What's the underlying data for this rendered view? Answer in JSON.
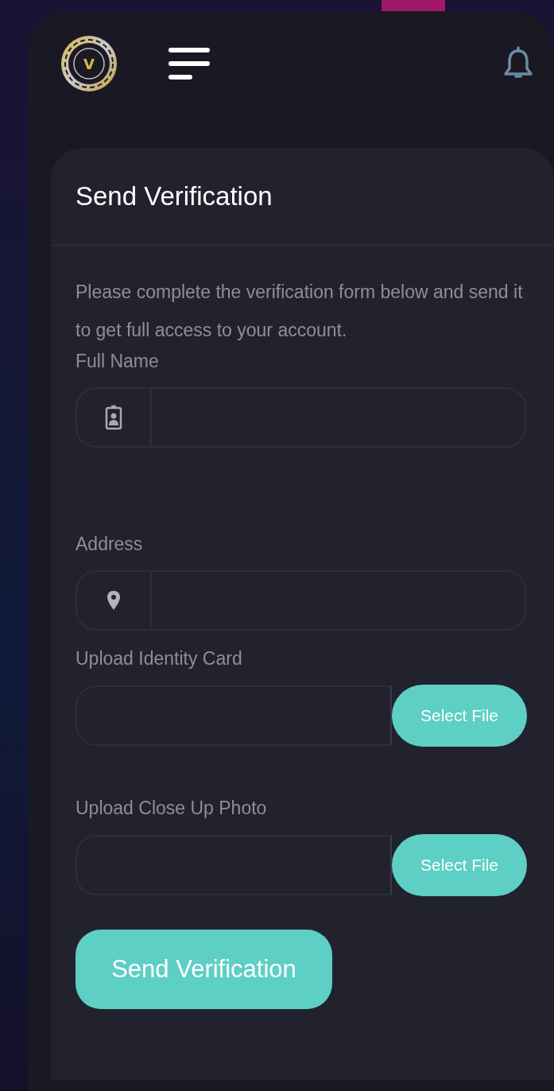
{
  "header": {
    "logo_letter": "V"
  },
  "card": {
    "title": "Send Verification",
    "description": "Please complete the verification form below and send it to get full access to your account."
  },
  "fields": [
    {
      "kind": "input",
      "label": "Full Name"
    },
    {
      "kind": "input",
      "label": "Address"
    },
    {
      "kind": "upload",
      "label": "Upload Identity Card",
      "button": "Select File"
    },
    {
      "kind": "upload",
      "label": "Upload Close Up Photo",
      "button": "Select File"
    }
  ],
  "submit": "Send Verification"
}
